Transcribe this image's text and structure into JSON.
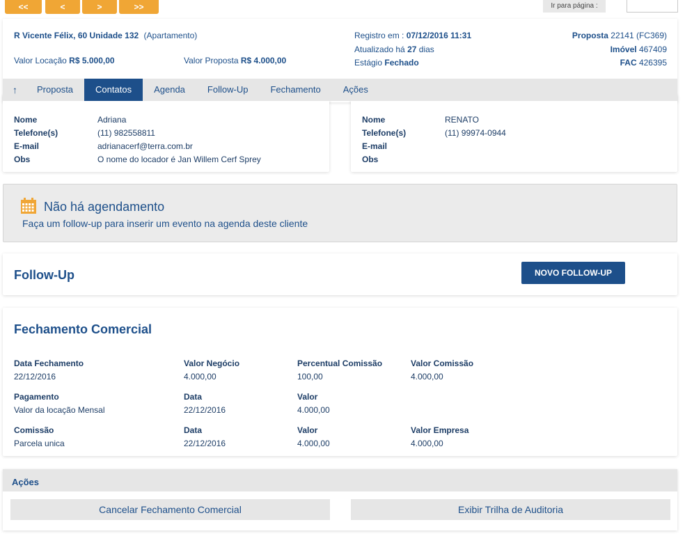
{
  "pagination": {
    "first": "<<",
    "prev": "<",
    "next": ">",
    "last": ">>",
    "goto_label": "Ir para página :",
    "goto_value": ""
  },
  "header": {
    "address": "R Vicente Félix, 60 Unidade 132",
    "property_type": "(Apartamento)",
    "valor_locacao_label": "Valor Locação",
    "valor_locacao_value": "R$ 5.000,00",
    "valor_proposta_label": "Valor Proposta",
    "valor_proposta_value": "R$ 4.000,00",
    "registro_label": "Registro em :",
    "registro_value": "07/12/2016 11:31",
    "atualizado_prefix": "Atualizado há",
    "atualizado_days": "27",
    "atualizado_suffix": "dias",
    "estagio_label": "Estágio",
    "estagio_value": "Fechado",
    "proposta_label": "Proposta",
    "proposta_value": "22141 (FC369)",
    "imovel_label": "Imóvel",
    "imovel_value": "467409",
    "fac_label": "FAC",
    "fac_value": "426395"
  },
  "tabs": {
    "up": "↑",
    "items": [
      "Proposta",
      "Contatos",
      "Agenda",
      "Follow-Up",
      "Fechamento",
      "Ações"
    ],
    "active": "Contatos"
  },
  "contact_left": {
    "nome_label": "Nome",
    "nome_value": "Adriana",
    "telefone_label": "Telefone(s)",
    "telefone_value": "(11) 982558811",
    "email_label": "E-mail",
    "email_value": "adrianacerf@terra.com.br",
    "obs_label": "Obs",
    "obs_value": "O nome do locador é Jan Willem Cerf Sprey"
  },
  "contact_right": {
    "nome_label": "Nome",
    "nome_value": "RENATO",
    "telefone_label": "Telefone(s)",
    "telefone_value": "(11) 99974-0944",
    "email_label": "E-mail",
    "email_value": "",
    "obs_label": "Obs",
    "obs_value": ""
  },
  "agenda": {
    "title": "Não há agendamento",
    "subtitle": "Faça um follow-up para inserir um evento na agenda deste cliente",
    "icon": "calendar-icon",
    "icon_color": "#f0a635"
  },
  "followup": {
    "title": "Follow-Up",
    "button": "NOVO FOLLOW-UP"
  },
  "fechamento": {
    "title": "Fechamento Comercial",
    "rows": [
      [
        {
          "label": "Data Fechamento",
          "value": "22/12/2016"
        },
        {
          "label": "Valor Negócio",
          "value": "4.000,00"
        },
        {
          "label": "Percentual Comissão",
          "value": "100,00"
        },
        {
          "label": "Valor Comissão",
          "value": "4.000,00"
        }
      ],
      [
        {
          "label": "Pagamento",
          "value": "Valor da locação Mensal"
        },
        {
          "label": "Data",
          "value": "22/12/2016"
        },
        {
          "label": "Valor",
          "value": "4.000,00"
        }
      ],
      [
        {
          "label": "Comissão",
          "value": "Parcela unica"
        },
        {
          "label": "Data",
          "value": "22/12/2016"
        },
        {
          "label": "Valor",
          "value": "4.000,00"
        },
        {
          "label": "Valor Empresa",
          "value": "4.000,00"
        }
      ]
    ]
  },
  "acoes": {
    "title": "Ações",
    "cancel_button": "Cancelar Fechamento Comercial",
    "audit_button": "Exibir Trilha de Auditoria"
  },
  "colors": {
    "accent_orange": "#f0a635",
    "primary_blue": "#1d4f8a"
  }
}
